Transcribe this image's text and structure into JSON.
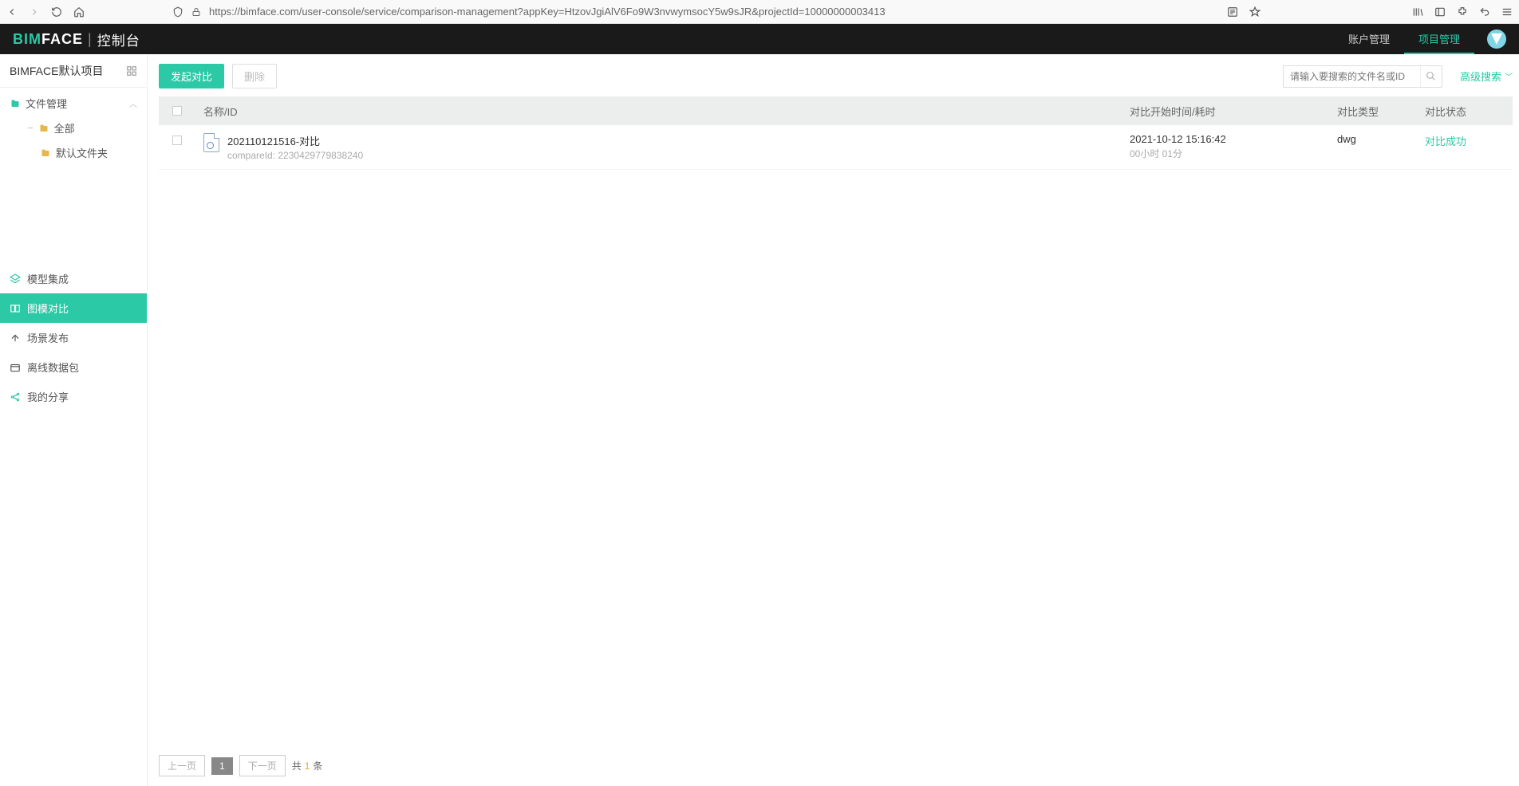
{
  "browser": {
    "url": "https://bimface.com/user-console/service/comparison-management?appKey=HtzovJgiAlV6Fo9W3nvwymsocY5w9sJR&projectId=10000000003413"
  },
  "header": {
    "logo_bim": "BIM",
    "logo_face": "FACE",
    "logo_cn": "控制台",
    "tabs": {
      "account": "账户管理",
      "project": "项目管理"
    }
  },
  "sidebar": {
    "project_name": "BIMFACE默认项目",
    "tree": {
      "file_mgmt": "文件管理",
      "all": "全部",
      "default_folder": "默认文件夹"
    },
    "nav": {
      "model_integration": "模型集成",
      "compare": "图模对比",
      "scene_publish": "场景发布",
      "offline_pkg": "离线数据包",
      "my_share": "我的分享"
    }
  },
  "toolbar": {
    "start_compare": "发起对比",
    "delete": "删除",
    "search_placeholder": "请输入要搜索的文件名或ID",
    "advanced_search": "高级搜索"
  },
  "table": {
    "headers": {
      "name": "名称/ID",
      "time": "对比开始时间/耗时",
      "type": "对比类型",
      "status": "对比状态"
    },
    "row": {
      "name": "202110121516-对比",
      "id_label": "compareId:",
      "id_value": "2230429779838240",
      "time": "2021-10-12 15:16:42",
      "duration": "00小时 01分",
      "type": "dwg",
      "status": "对比成功"
    }
  },
  "pager": {
    "prev": "上一页",
    "page": "1",
    "next": "下一页",
    "total_prefix": "共",
    "total_n": "1",
    "total_suffix": "条"
  }
}
